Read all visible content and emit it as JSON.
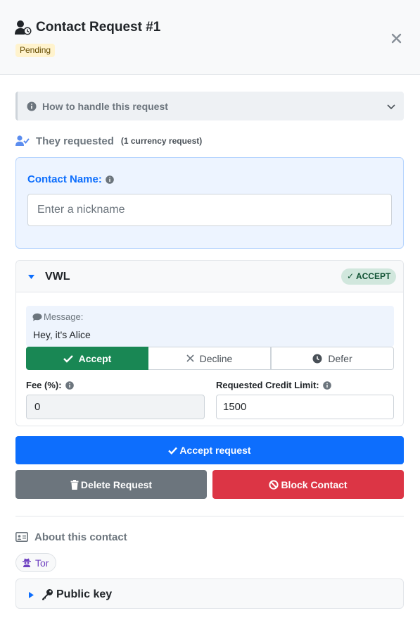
{
  "header": {
    "title": "Contact Request #1",
    "status_badge": "Pending",
    "icons": {
      "title": "user-clock-icon",
      "close": "close-icon"
    }
  },
  "howto": {
    "label": "How to handle this request",
    "icons": [
      "info-circle-icon",
      "chevron-down-icon"
    ]
  },
  "requested": {
    "label": "They requested",
    "count": "(1 currency request)",
    "icon": "user-check-icon"
  },
  "contact": {
    "name_label": "Contact Name:",
    "nickname_placeholder": "Enter a nickname",
    "nickname_value": ""
  },
  "currency": {
    "code": "VWL",
    "badge": "✓ ACCEPT",
    "message_label": "Message:",
    "message_text": "Hey, it's Alice",
    "actions": {
      "accept": "Accept",
      "decline": "Decline",
      "defer": "Defer",
      "selected": "Accept"
    },
    "fee_label": "Fee (%):",
    "fee_value": "0",
    "credit_label": "Requested Credit Limit:",
    "credit_value": "1500"
  },
  "buttons": {
    "accept_request": "Accept request",
    "delete_request": "Delete Request",
    "block_contact": "Block Contact"
  },
  "about": {
    "label": "About this contact",
    "network_tag": "Tor",
    "public_key_label": "Public key"
  },
  "colors": {
    "primary": "#0d6efd",
    "success": "#198754",
    "danger": "#dc3545",
    "secondary": "#6c757d",
    "pending_bg": "#fff3cd",
    "tor": "#6f42c1"
  }
}
